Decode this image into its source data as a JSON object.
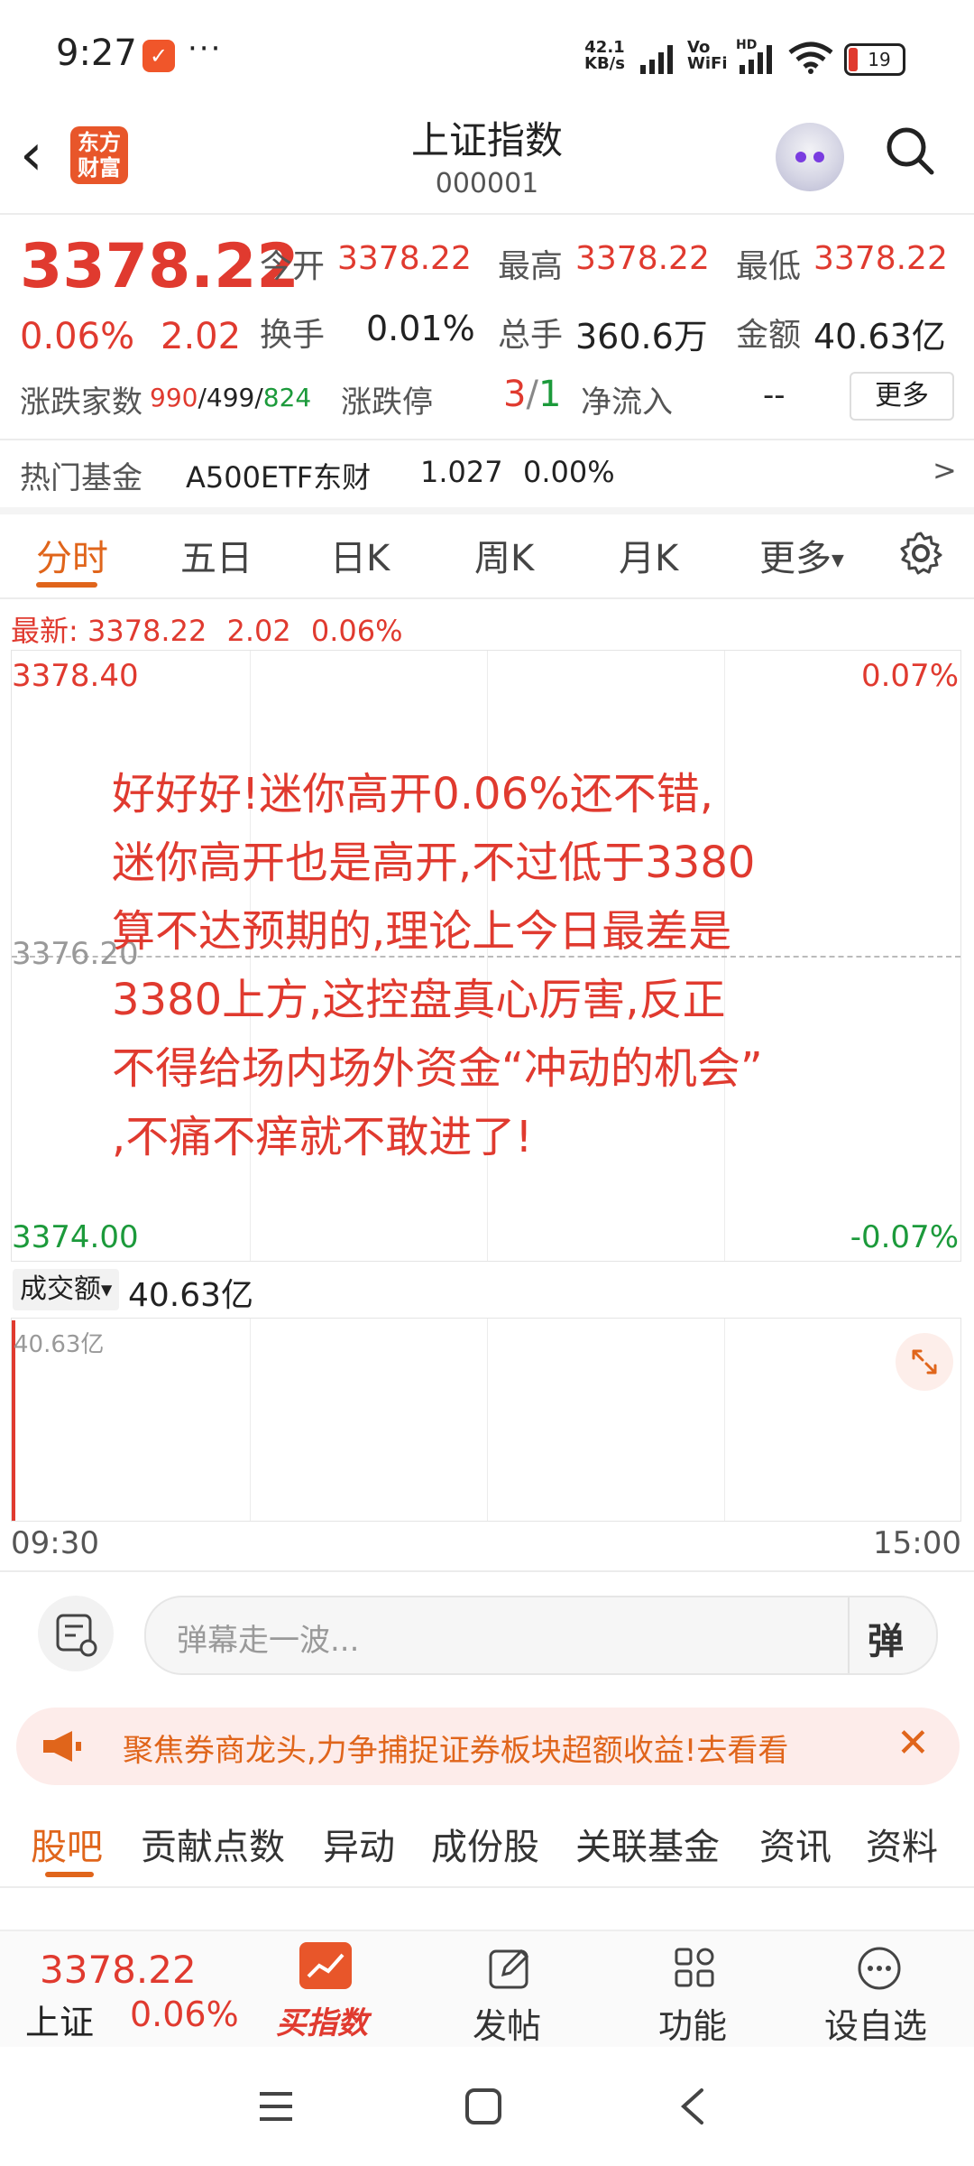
{
  "status_bar": {
    "time": "9:27",
    "app_badge": "✓",
    "more": "···",
    "net_speed_value": "42.1",
    "net_speed_unit": "KB/s",
    "vowifi": "Vo WiFi",
    "hd": "HD",
    "battery": "19"
  },
  "header": {
    "logo_line1": "东方",
    "logo_line2": "财富",
    "title": "上证指数",
    "code": "000001"
  },
  "quote": {
    "price": "3378.22",
    "change_pct": "0.06%",
    "change": "2.02",
    "open_label": "今开",
    "open": "3378.22",
    "high_label": "最高",
    "high": "3378.22",
    "low_label": "最低",
    "low": "3378.22",
    "turnover_label": "换手",
    "turnover": "0.01%",
    "volume_label": "总手",
    "volume": "360.6万",
    "amount_label": "金额",
    "amount": "40.63亿",
    "breadth_label": "涨跌家数",
    "up_count": "990",
    "flat_count": "499",
    "down_count": "824",
    "sep": "/",
    "limit_label": "涨跌停",
    "limit_up": "3",
    "limit_down": "1",
    "netflow_label": "净流入",
    "netflow": "--",
    "more_button": "更多"
  },
  "hot_fund": {
    "label": "热门基金",
    "name": "A500ETF东财",
    "price": "1.027",
    "change": "0.00%",
    "arrow": ">"
  },
  "period_tabs": [
    "分时",
    "五日",
    "日K",
    "周K",
    "月K",
    "更多"
  ],
  "chart": {
    "latest_label": "最新:",
    "latest_price": "3378.22",
    "latest_change": "2.02",
    "latest_pct": "0.06%",
    "y_top": "3378.40",
    "y_mid": "3376.20",
    "y_bottom": "3374.00",
    "pct_top": "0.07%",
    "pct_bottom": "-0.07%",
    "overlay_lines": [
      "好好好!迷你高开0.06%还不错,",
      "迷你高开也是高开,不过低于3380",
      "算不达预期的,理论上今日最差是",
      "3380上方,这控盘真心厉害,反正",
      "不得给场内场外资金“冲动的机会”",
      ",不痛不痒就不敢进了!"
    ],
    "volume_selector": "成交额",
    "volume_value": "40.63亿",
    "volume_axis": "40.63亿",
    "time_start": "09:30",
    "time_end": "15:00"
  },
  "comment_bar": {
    "placeholder": "弹幕走一波...",
    "danmu_button": "弹"
  },
  "banner": {
    "text": "聚焦券商龙头,力争捕捉证券板块超额收益!去看看"
  },
  "bottom_tabs": [
    "股吧",
    "贡献点数",
    "异动",
    "成份股",
    "关联基金",
    "资讯",
    "资料"
  ],
  "footer": {
    "price": "3378.22",
    "name": "上证",
    "pct": "0.06%",
    "buy_label": "买指数",
    "post_label": "发帖",
    "function_label": "功能",
    "watchlist_label": "设自选"
  },
  "colors": {
    "up_red": "#e03a2f",
    "down_green": "#1c9a3b",
    "accent_orange": "#e0651b"
  }
}
